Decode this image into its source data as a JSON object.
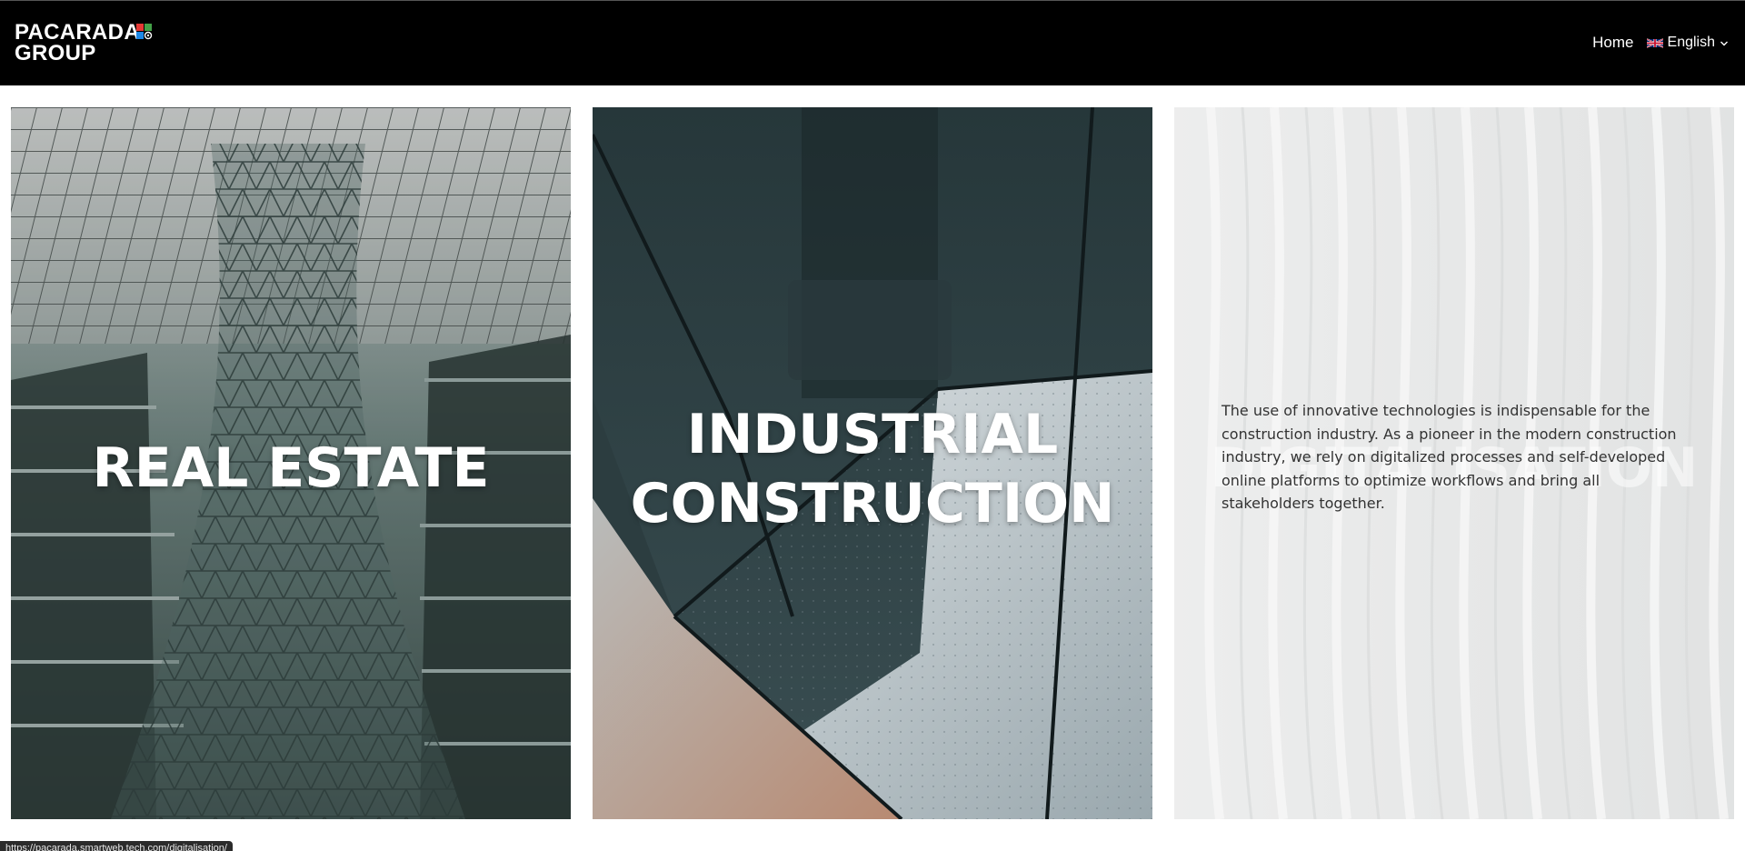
{
  "header": {
    "logo_line1": "PACARADA",
    "logo_line2": "GROUP",
    "nav_home": "Home",
    "language": "English",
    "logo_colors": [
      "#e53935",
      "#43a047",
      "#1e88e5"
    ]
  },
  "tiles": [
    {
      "title": "REAL ESTATE",
      "icon": "real-estate-photo"
    },
    {
      "title_line1": "INDUSTRIAL",
      "title_line2": "CONSTRUCTION",
      "icon": "industrial-construction-photo"
    },
    {
      "title": "DIGITALISATION",
      "description": "The use of innovative technologies is indispensable for the construction industry. As a pioneer in the modern construction industry, we rely on digitalized processes and self-developed online platforms to optimize workflows and bring all stakeholders together.",
      "icon": "digitalisation-photo"
    }
  ],
  "status_bar": {
    "url": "https://pacarada.smartweb.tech.com/digitalisation/"
  }
}
